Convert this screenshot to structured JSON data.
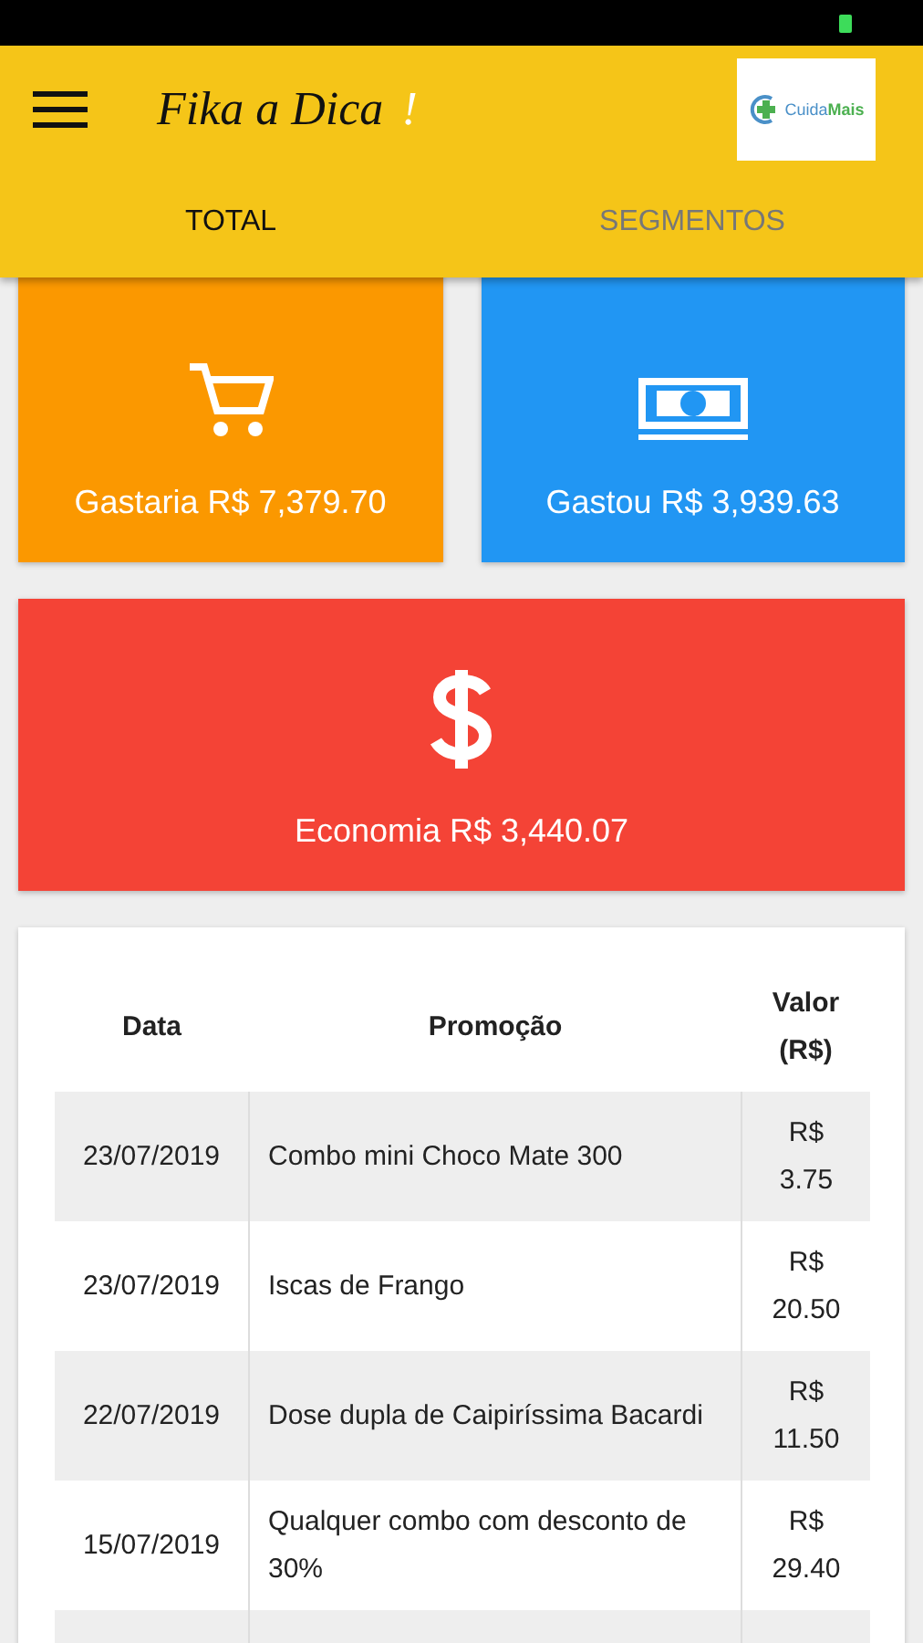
{
  "app_bar": {
    "title": "Fika a Dica",
    "title_mark": "!",
    "logo_text": "Cuida**Mais**"
  },
  "tabs": [
    {
      "label": "TOTAL",
      "selected": true
    },
    {
      "label": "SEGMENTOS",
      "selected": false
    }
  ],
  "cards": [
    {
      "kind": "cart",
      "label": "Gastaria R$ 7,379.70",
      "color": "#fb9800"
    },
    {
      "kind": "money",
      "label": "Gastou R$ 3,939.63",
      "color": "#2196f3"
    },
    {
      "kind": "dollar",
      "label": "Economia R$ 3,440.07",
      "color": "#f44336"
    }
  ],
  "table": {
    "columns": [
      "Data",
      "Promoção",
      "Valor (R$)"
    ],
    "rows": [
      {
        "date": "23/07/2019",
        "promo": "Combo mini Choco Mate 300",
        "value": "R$ 3.75"
      },
      {
        "date": "23/07/2019",
        "promo": "Iscas de Frango",
        "value": "R$ 20.50"
      },
      {
        "date": "22/07/2019",
        "promo": "Dose dupla de Caipiríssima Bacardi",
        "value": "R$ 11.50"
      },
      {
        "date": "15/07/2019",
        "promo": "Qualquer combo com desconto de 30%",
        "value": "R$ 29.40"
      }
    ]
  }
}
